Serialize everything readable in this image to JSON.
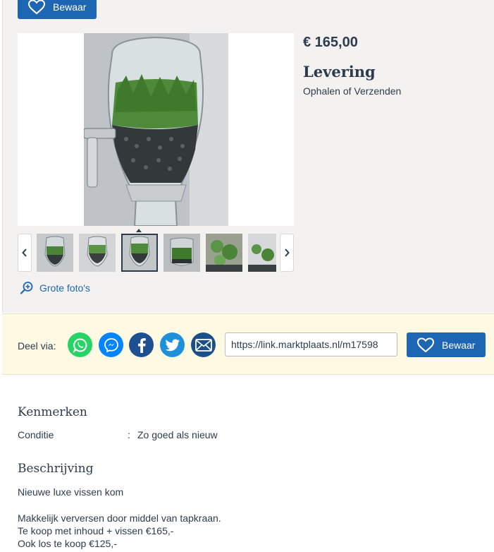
{
  "top_bewaar_label": "Bewaar",
  "listing": {
    "price": "€ 165,00",
    "delivery_title": "Levering",
    "delivery_text": "Ophalen of Verzenden"
  },
  "gallery": {
    "thumb_count": 6,
    "active_thumb": 3,
    "large_photos_label": "Grote foto's"
  },
  "share": {
    "label": "Deel via:",
    "icons": [
      "whatsapp-icon",
      "messenger-icon",
      "facebook-icon",
      "twitter-icon",
      "email-icon"
    ],
    "colors": {
      "whatsapp": "#25d366",
      "messenger": "#0084ff",
      "facebook": "#1d4f91",
      "twitter": "#1d8fdb",
      "email": "#1b4f87"
    },
    "url": "https://link.marktplaats.nl/m17598",
    "bewaar_label": "Bewaar"
  },
  "kenmerken": {
    "title": "Kenmerken",
    "key": "Conditie",
    "separator": ":",
    "value": "Zo goed als nieuw"
  },
  "beschrijving": {
    "title": "Beschrijving",
    "lines": [
      "Nieuwe luxe vissen kom",
      "Makkelijk verversen door middel van tapkraan.",
      "Te koop met inhoud + vissen €165,-",
      "Ook los te koop €125,-"
    ]
  },
  "colors": {
    "accent": "#1d66b3",
    "panel_bg": "#f3f2f0",
    "share_bg": "#fdf9e3",
    "text": "#2d3c4d"
  }
}
